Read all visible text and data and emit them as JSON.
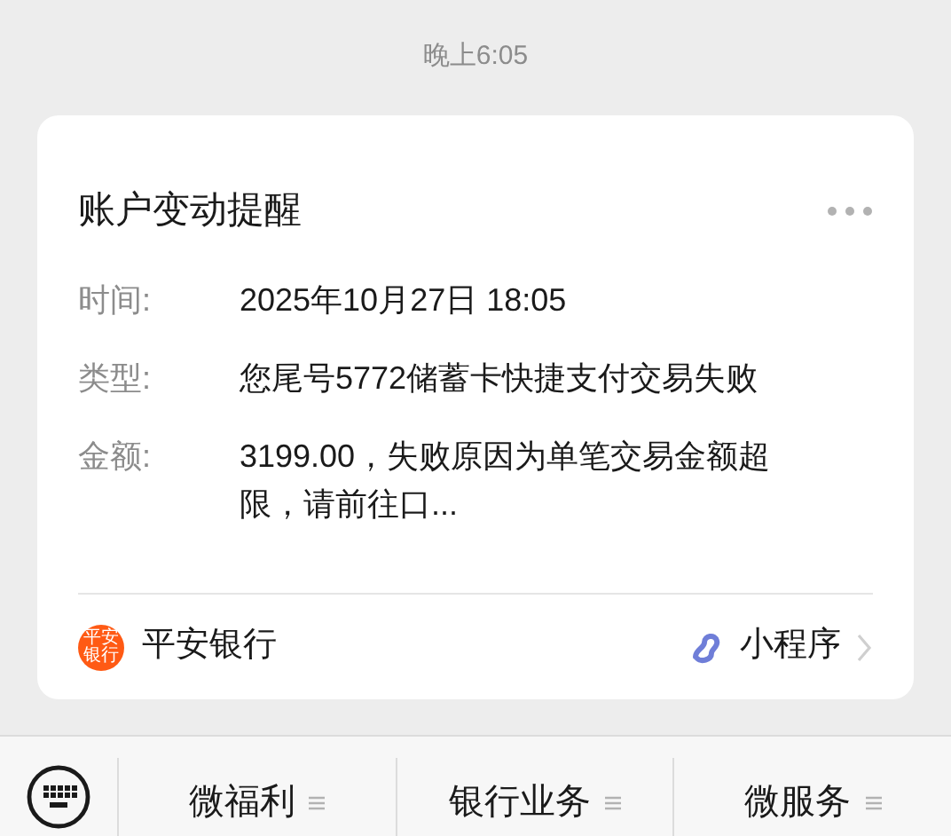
{
  "timestamp": "晚上6:05",
  "card": {
    "title": "账户变动提醒",
    "fields": [
      {
        "label": "时间:",
        "value": "2025年10月27日 18:05"
      },
      {
        "label": "类型:",
        "value": "您尾号5772储蓄卡快捷支付交易失败"
      },
      {
        "label": "金额:",
        "value": "3199.00，失败原因为单笔交易金额超限，请前往口..."
      }
    ],
    "footer": {
      "logo_text": [
        "平安",
        "银行"
      ],
      "account": "平安银行",
      "link": "小程序"
    }
  },
  "menu_bar": {
    "tabs": [
      "微福利",
      "银行业务",
      "微服务"
    ]
  }
}
